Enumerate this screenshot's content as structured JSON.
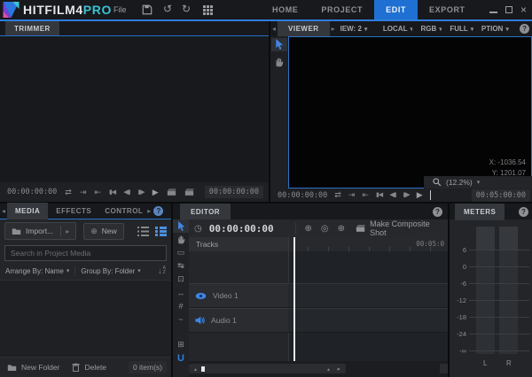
{
  "titlebar": {
    "logo_text": "HITFILM4",
    "logo_accent": "PRO",
    "file_menu": "File",
    "nav_tabs": [
      "HOME",
      "PROJECT",
      "EDIT",
      "EXPORT"
    ]
  },
  "icons": {
    "help": "?",
    "dropdown": "▾",
    "tab_prev": "◂",
    "tab_next": "▸",
    "undo": "↺",
    "redo": "↻",
    "loop": "⇄",
    "goto_out": "⇥",
    "goto_in": "⇤",
    "jump_start": "▮◀",
    "step_back": "◀▮",
    "step_fwd": "▮▶",
    "play": "▶",
    "circle_plus_in": "⊕",
    "circle_marker": "◎",
    "circle_plus_out": "⊕",
    "clock": "◷",
    "new_plus": "⊕"
  },
  "trimmer": {
    "tab": "TRIMMER",
    "current_time": "00:00:00:00",
    "end_time": "00:00:00:00"
  },
  "viewer": {
    "tab": "VIEWER",
    "dropdowns": [
      "IEW: 2",
      "LOCAL",
      "RGB",
      "FULL",
      "PTION"
    ],
    "coord_x": "X: -1036.54",
    "coord_y": "Y: 1201.07",
    "zoom_level": "(12.2%)",
    "current_time": "00:00:00:00",
    "end_time": "00:05:00:00"
  },
  "media": {
    "tabs": [
      "MEDIA",
      "EFFECTS",
      "CONTROL"
    ],
    "import_label": "Import...",
    "new_label": "New",
    "search_placeholder": "Search in Project Media",
    "arrange_by": "Arrange By: Name",
    "group_by": "Group By: Folder",
    "new_folder_label": "New Folder",
    "delete_label": "Delete",
    "item_count": "0 item(s)"
  },
  "editor": {
    "tab": "EDITOR",
    "timecode": "00:00:00:00",
    "make_composite_label": "Make Composite Shot",
    "tracks_header": "Tracks",
    "ruler_end_label": "00:05:0",
    "tools": [
      "▭",
      "↹",
      "⊡",
      "↔",
      "#",
      "~",
      "⊞",
      "U"
    ],
    "tracks": [
      {
        "name": "Video 1"
      },
      {
        "name": "Audio 1"
      }
    ]
  },
  "meters": {
    "tab": "METERS",
    "scale": [
      "6",
      "0",
      "-6",
      "-12",
      "-18",
      "-24",
      "-∞"
    ],
    "channels": [
      "L",
      "R"
    ]
  }
}
